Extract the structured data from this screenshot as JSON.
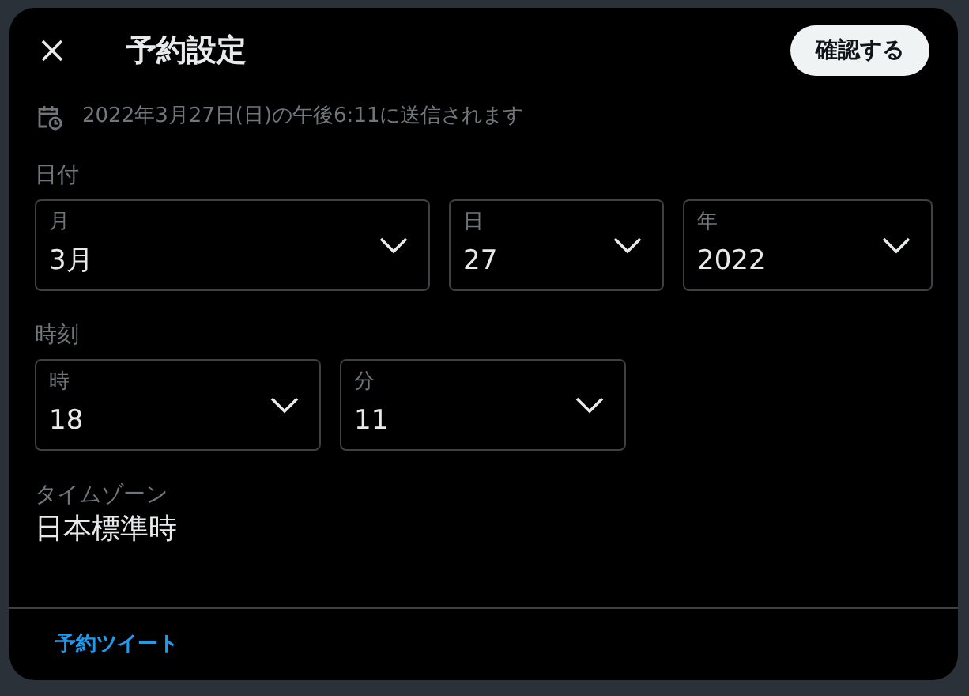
{
  "dialog": {
    "title": "予約設定",
    "confirm_button": "確認する"
  },
  "notice": "2022年3月27日(日)の午後6:11に送信されます",
  "date": {
    "label": "日付",
    "selects": [
      {
        "label": "月",
        "value": "3月"
      },
      {
        "label": "日",
        "value": "27"
      },
      {
        "label": "年",
        "value": "2022"
      }
    ]
  },
  "time": {
    "label": "時刻",
    "selects": [
      {
        "label": "時",
        "value": "18"
      },
      {
        "label": "分",
        "value": "11"
      }
    ]
  },
  "timezone": {
    "label": "タイムゾーン",
    "value": "日本標準時"
  },
  "footer_link": "予約ツイート"
}
